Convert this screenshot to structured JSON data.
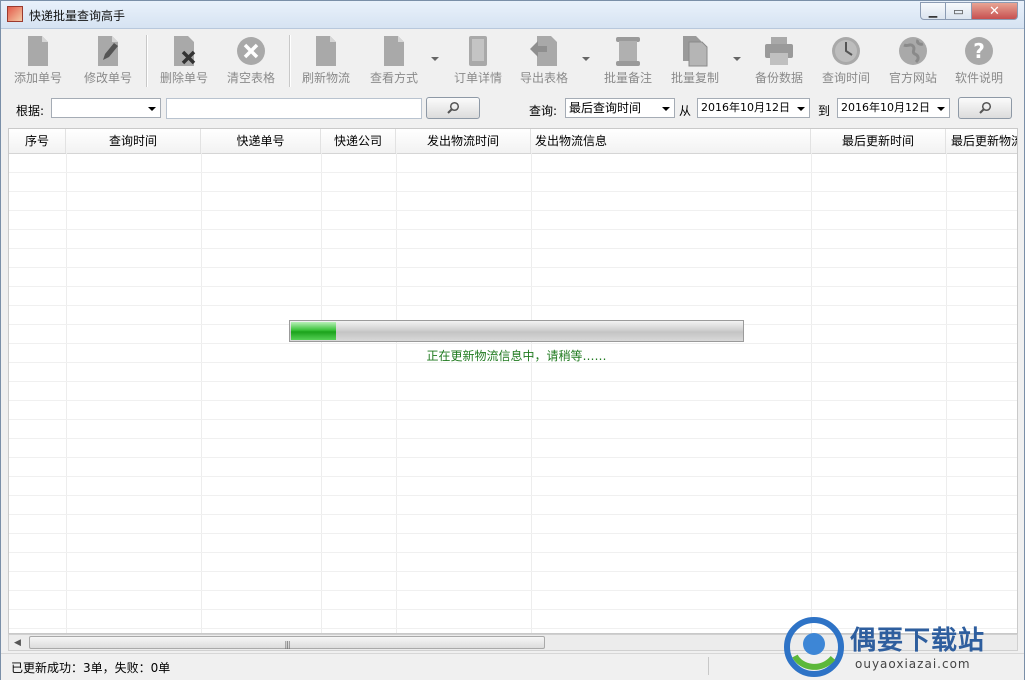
{
  "window": {
    "title": "快递批量查询高手"
  },
  "toolbar": {
    "items": [
      {
        "label": "添加单号",
        "icon": "document-add-icon"
      },
      {
        "label": "修改单号",
        "icon": "document-edit-icon"
      },
      {
        "label": "删除单号",
        "icon": "document-delete-icon"
      },
      {
        "label": "清空表格",
        "icon": "clear-circle-icon"
      },
      {
        "label": "刷新物流",
        "icon": "document-refresh-icon"
      },
      {
        "label": "查看方式",
        "icon": "document-view-icon"
      },
      {
        "label": "订单详情",
        "icon": "order-detail-icon"
      },
      {
        "label": "导出表格",
        "icon": "export-icon"
      },
      {
        "label": "批量备注",
        "icon": "scroll-note-icon"
      },
      {
        "label": "批量复制",
        "icon": "copy-icon"
      },
      {
        "label": "备份数据",
        "icon": "backup-printer-icon"
      },
      {
        "label": "查询时间",
        "icon": "clock-icon"
      },
      {
        "label": "官方网站",
        "icon": "globe-icon"
      },
      {
        "label": "软件说明",
        "icon": "help-icon"
      }
    ]
  },
  "filter": {
    "basis_label": "根据:",
    "basis_value": "",
    "keyword_value": "",
    "query_label": "查询:",
    "query_value": "最后查询时间",
    "from_label": "从",
    "from_date": "2016年10月12日",
    "to_label": "到",
    "to_date": "2016年10月12日"
  },
  "grid": {
    "columns": [
      "序号",
      "查询时间",
      "快递单号",
      "快递公司",
      "发出物流时间",
      "发出物流信息",
      "最后更新时间",
      "最后更新物流"
    ],
    "rows": []
  },
  "progress": {
    "value": 0.1,
    "message": "正在更新物流信息中，请稍等……"
  },
  "status": {
    "text": "已更新成功：3单，失败：0单"
  },
  "watermark": {
    "title": "偶要下载站",
    "url": "ouyaoxiazai.com"
  },
  "colors": {
    "progress_green": "#2db52d",
    "status_text_green": "#1f7a1f",
    "toolbar_icon_gray": "#9a9a9a"
  }
}
